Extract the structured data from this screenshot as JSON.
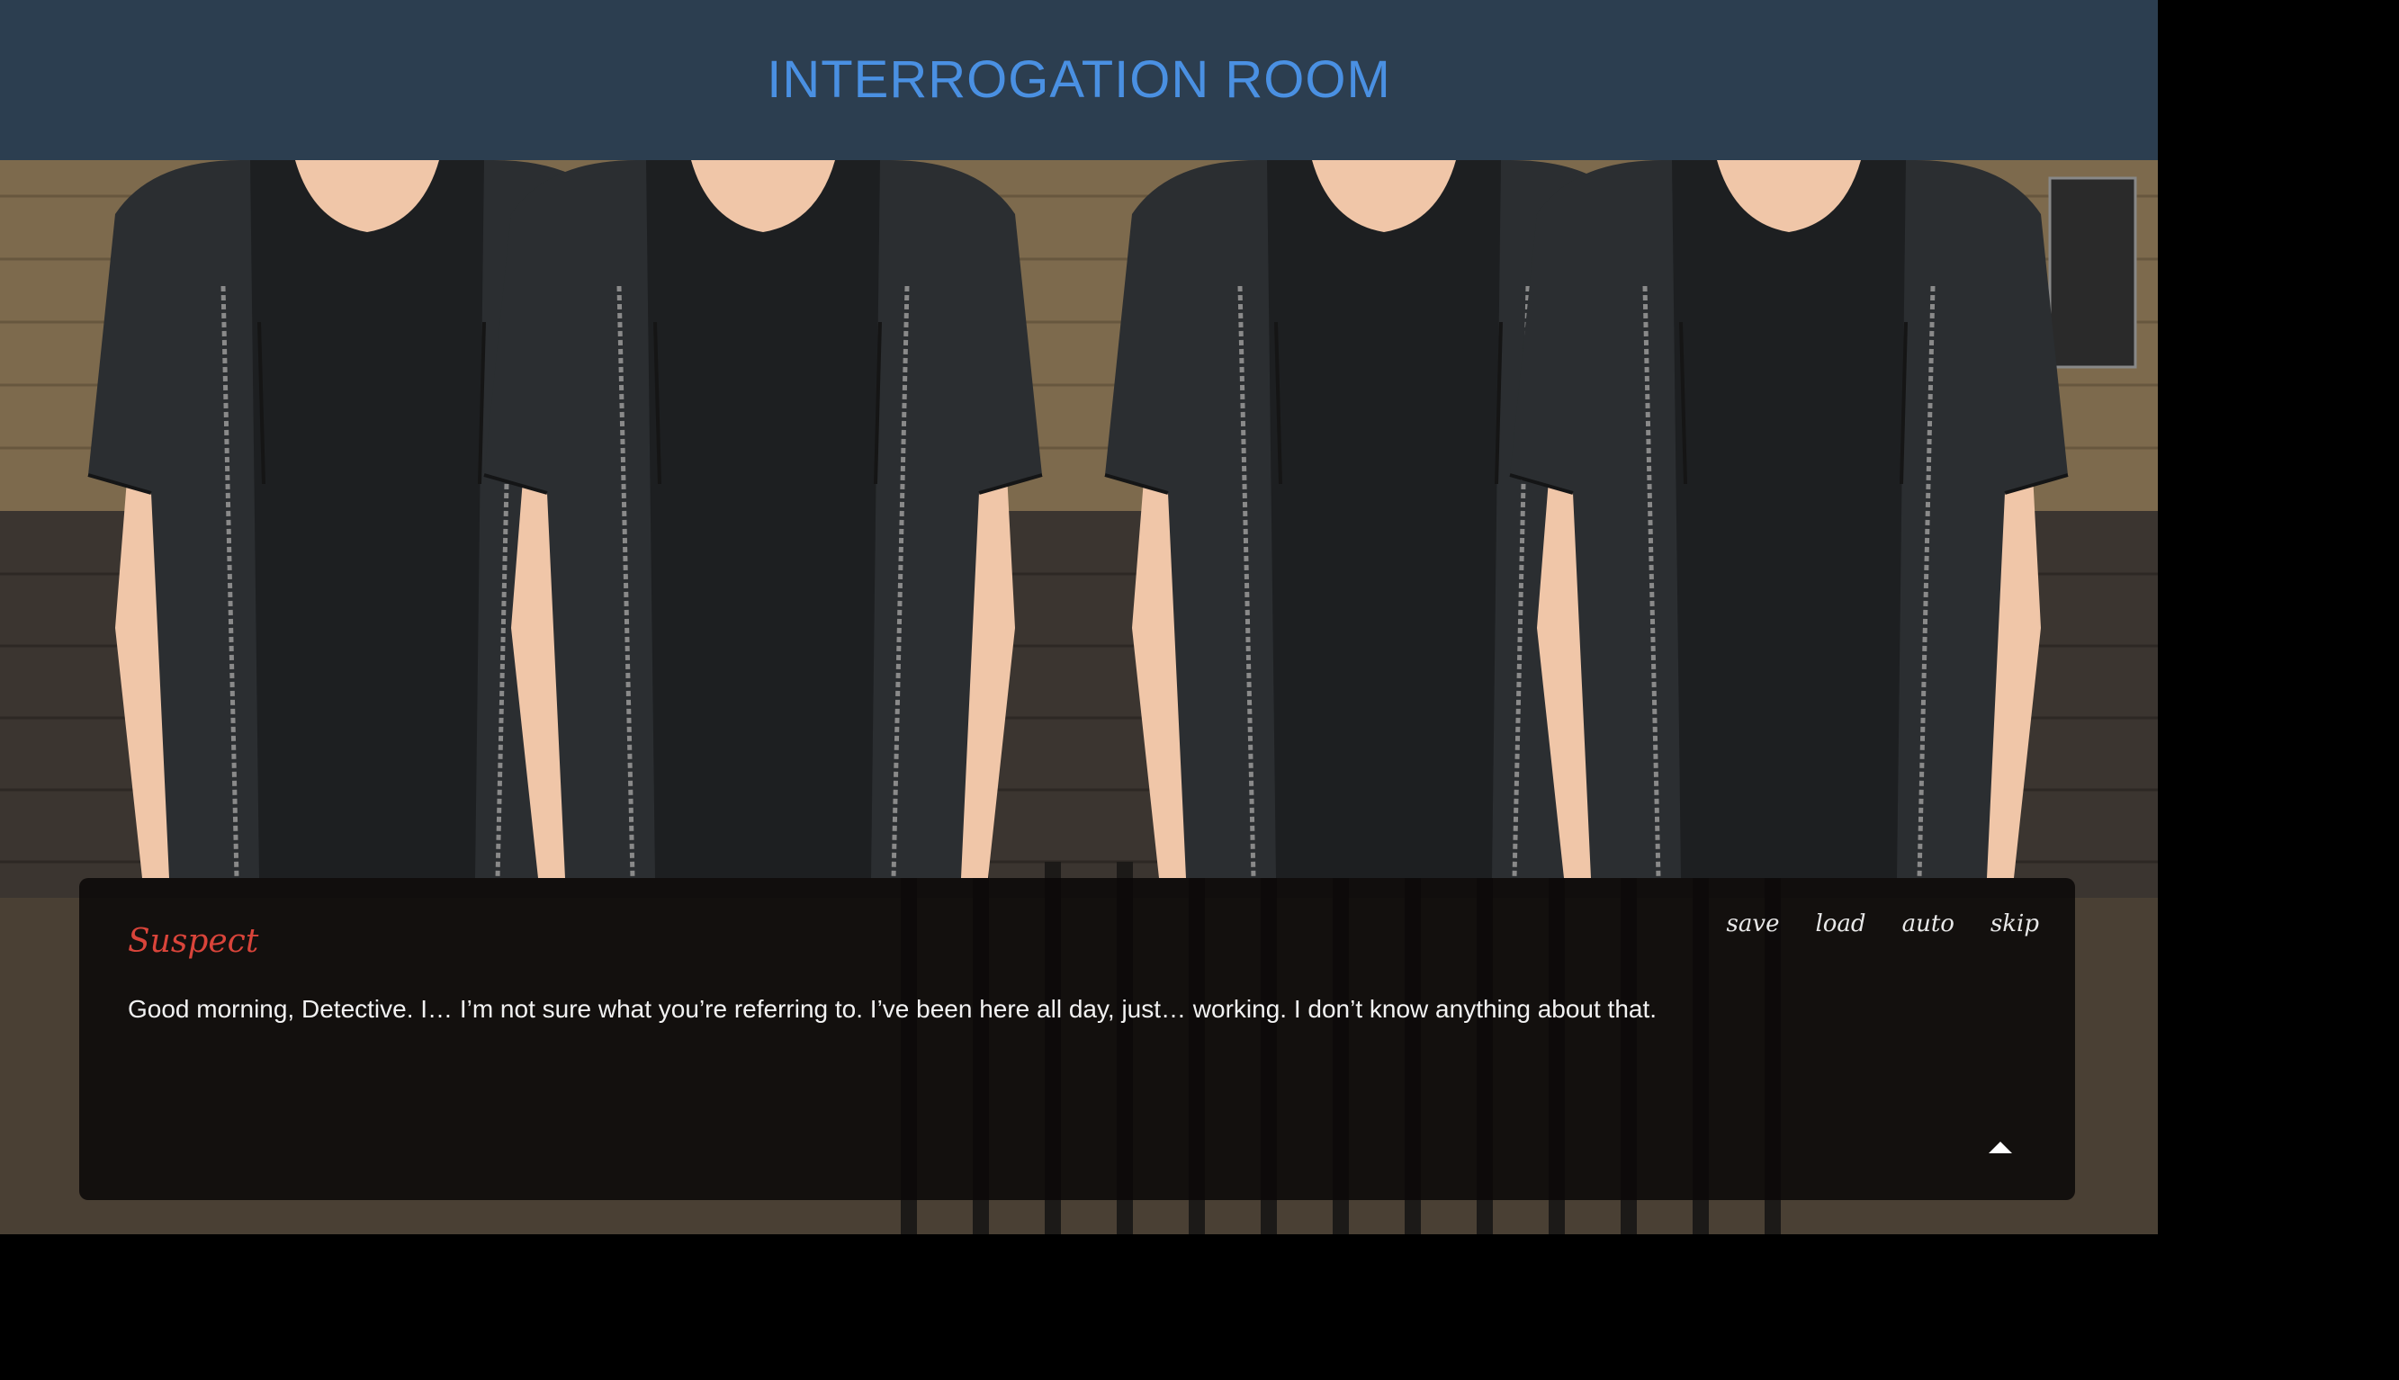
{
  "header": {
    "title": "INTERROGATION ROOM"
  },
  "scene": {
    "background": "jail-cell-background",
    "sprite": "suspect-character-sprite",
    "sprite_copies": 4
  },
  "dialog": {
    "speaker": "Suspect",
    "text": "Good morning, Detective. I… I’m not sure what you’re referring to. I’ve been here all day, just… working. I don’t know anything about that.",
    "speaker_color": "#d9443a"
  },
  "controls": {
    "save": "save",
    "load": "load",
    "auto": "auto",
    "skip": "skip"
  },
  "advance_icon": "triangle-up-icon",
  "colors": {
    "header_bg": "#2c3e50",
    "header_text": "#4a90e2",
    "dialog_bg": "#0a0808"
  }
}
